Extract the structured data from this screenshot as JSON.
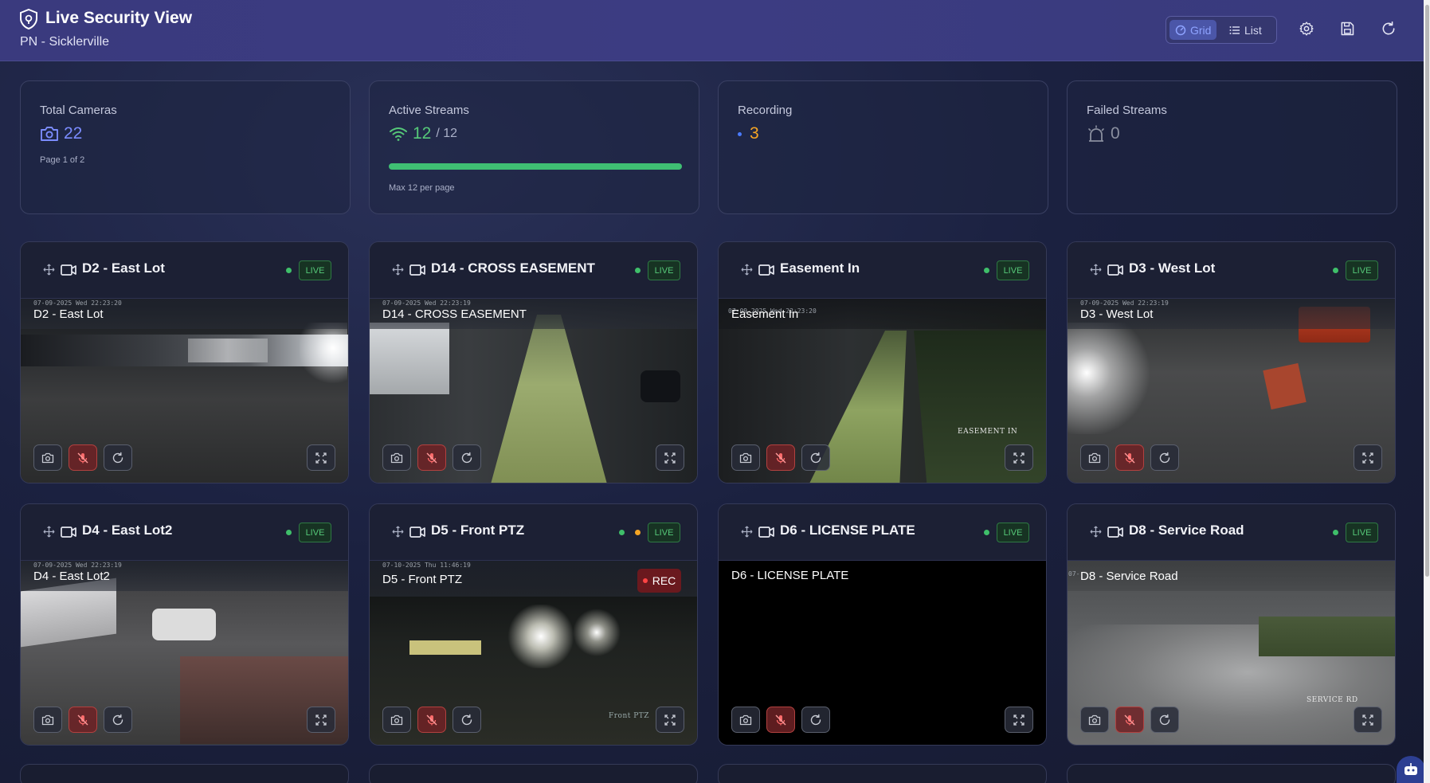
{
  "header": {
    "title": "Live Security View",
    "subtitle": "PN - Sicklerville",
    "view_toggle": {
      "grid_label": "Grid",
      "list_label": "List",
      "selected": "Grid"
    },
    "icons": [
      "shield-icon",
      "settings-gear-icon",
      "save-icon",
      "refresh-icon"
    ]
  },
  "stats": {
    "total_cameras": {
      "label": "Total Cameras",
      "value": "22",
      "note": "Page 1 of 2"
    },
    "active_streams": {
      "label": "Active Streams",
      "value": "12",
      "of": "/ 12",
      "note": "Max 12 per page",
      "progress_fraction": 1.0
    },
    "recording": {
      "label": "Recording",
      "value": "3"
    },
    "failed_streams": {
      "label": "Failed Streams",
      "value": "0"
    }
  },
  "cameras": [
    {
      "name": "D2 - East Lot",
      "status": "LIVE",
      "overlay_label": "D2 - East Lot",
      "timestamp": "07-09-2025 Wed 22:23:20",
      "recording": false
    },
    {
      "name": "D14 - CROSS EASEMENT",
      "status": "LIVE",
      "overlay_label": "D14 - CROSS EASEMENT",
      "timestamp": "07-09-2025 Wed 22:23:19",
      "recording": false
    },
    {
      "name": "Easement In",
      "status": "LIVE",
      "overlay_label": "Easement In",
      "timestamp": "07-09-2025 Wed 22:23:20",
      "overlay_tag": "EASEMENT IN",
      "recording": false
    },
    {
      "name": "D3 - West Lot",
      "status": "LIVE",
      "overlay_label": "D3 - West Lot",
      "timestamp": "07-09-2025 Wed 22:23:19",
      "recording": false
    },
    {
      "name": "D4 - East Lot2",
      "status": "LIVE",
      "overlay_label": "D4 - East Lot2",
      "timestamp": "07-09-2025 Wed 22:23:19",
      "recording": false
    },
    {
      "name": "D5 - Front PTZ",
      "status": "LIVE",
      "overlay_label": "D5 - Front PTZ",
      "timestamp": "07-10-2025 Thu 11:46:19",
      "overlay_tag": "Front PTZ",
      "recording": true,
      "rec_label": "REC"
    },
    {
      "name": "D6 - LICENSE PLATE",
      "status": "LIVE",
      "overlay_label": "D6 - LICENSE PLATE",
      "timestamp": "",
      "recording": false
    },
    {
      "name": "D8 - Service Road",
      "status": "LIVE",
      "overlay_label": "D8 - Service Road",
      "timestamp": "07-",
      "overlay_tag": "SERVICE RD",
      "recording": false
    }
  ],
  "camera_controls": [
    "camera-snapshot-icon",
    "microphone-icon",
    "refresh-icon",
    "fullscreen-icon"
  ],
  "colors": {
    "header_bg": "#3a3a7e",
    "accent_blue": "#7b8cff",
    "live_green": "#56c979",
    "recording_orange": "#f5a524",
    "rec_red": "#ff4444"
  }
}
